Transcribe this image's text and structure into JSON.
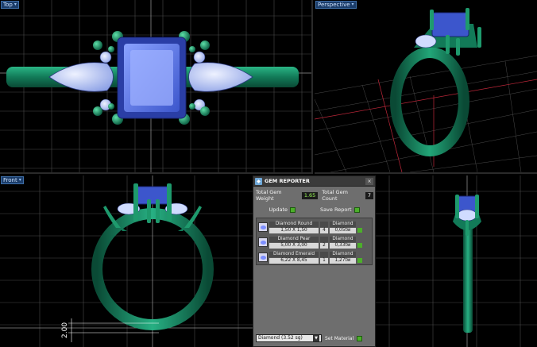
{
  "viewports": {
    "top_label": "Top",
    "perspective_label": "Perspective",
    "front_label": "Front"
  },
  "dimension": {
    "value": "2.00"
  },
  "gem_reporter": {
    "title": "GEM REPORTER",
    "total_weight_label": "Total Gem Weight",
    "total_weight_value": "1.65",
    "total_count_label": "Total Gem Count",
    "total_count_value": "7",
    "update_label": "Update",
    "save_report_label": "Save Report",
    "gems": [
      {
        "name": "Diamond Round",
        "size": "1,50 X 1,50",
        "material": "Diamond",
        "count": "4",
        "weight": "0,05tw"
      },
      {
        "name": "Diamond Pear",
        "size": "5,00 X 3,00",
        "material": "Diamond",
        "count": "2",
        "weight": "0,33tw"
      },
      {
        "name": "Diamond Emerald",
        "size": "6,22 X 8,45",
        "material": "Diamond",
        "count": "1",
        "weight": "1,27tw"
      }
    ],
    "material_select": "Diamond",
    "material_select_detail": "(3.52 sg)",
    "set_material_label": "Set Material"
  },
  "colors": {
    "metal": "#1a8f6a",
    "metal_dark": "#0b4e3a",
    "gem_blue": "#5a7ae8",
    "gem_light": "#c9d4ff",
    "grid": "#5a5a5a",
    "grid_red": "#c0273a"
  }
}
